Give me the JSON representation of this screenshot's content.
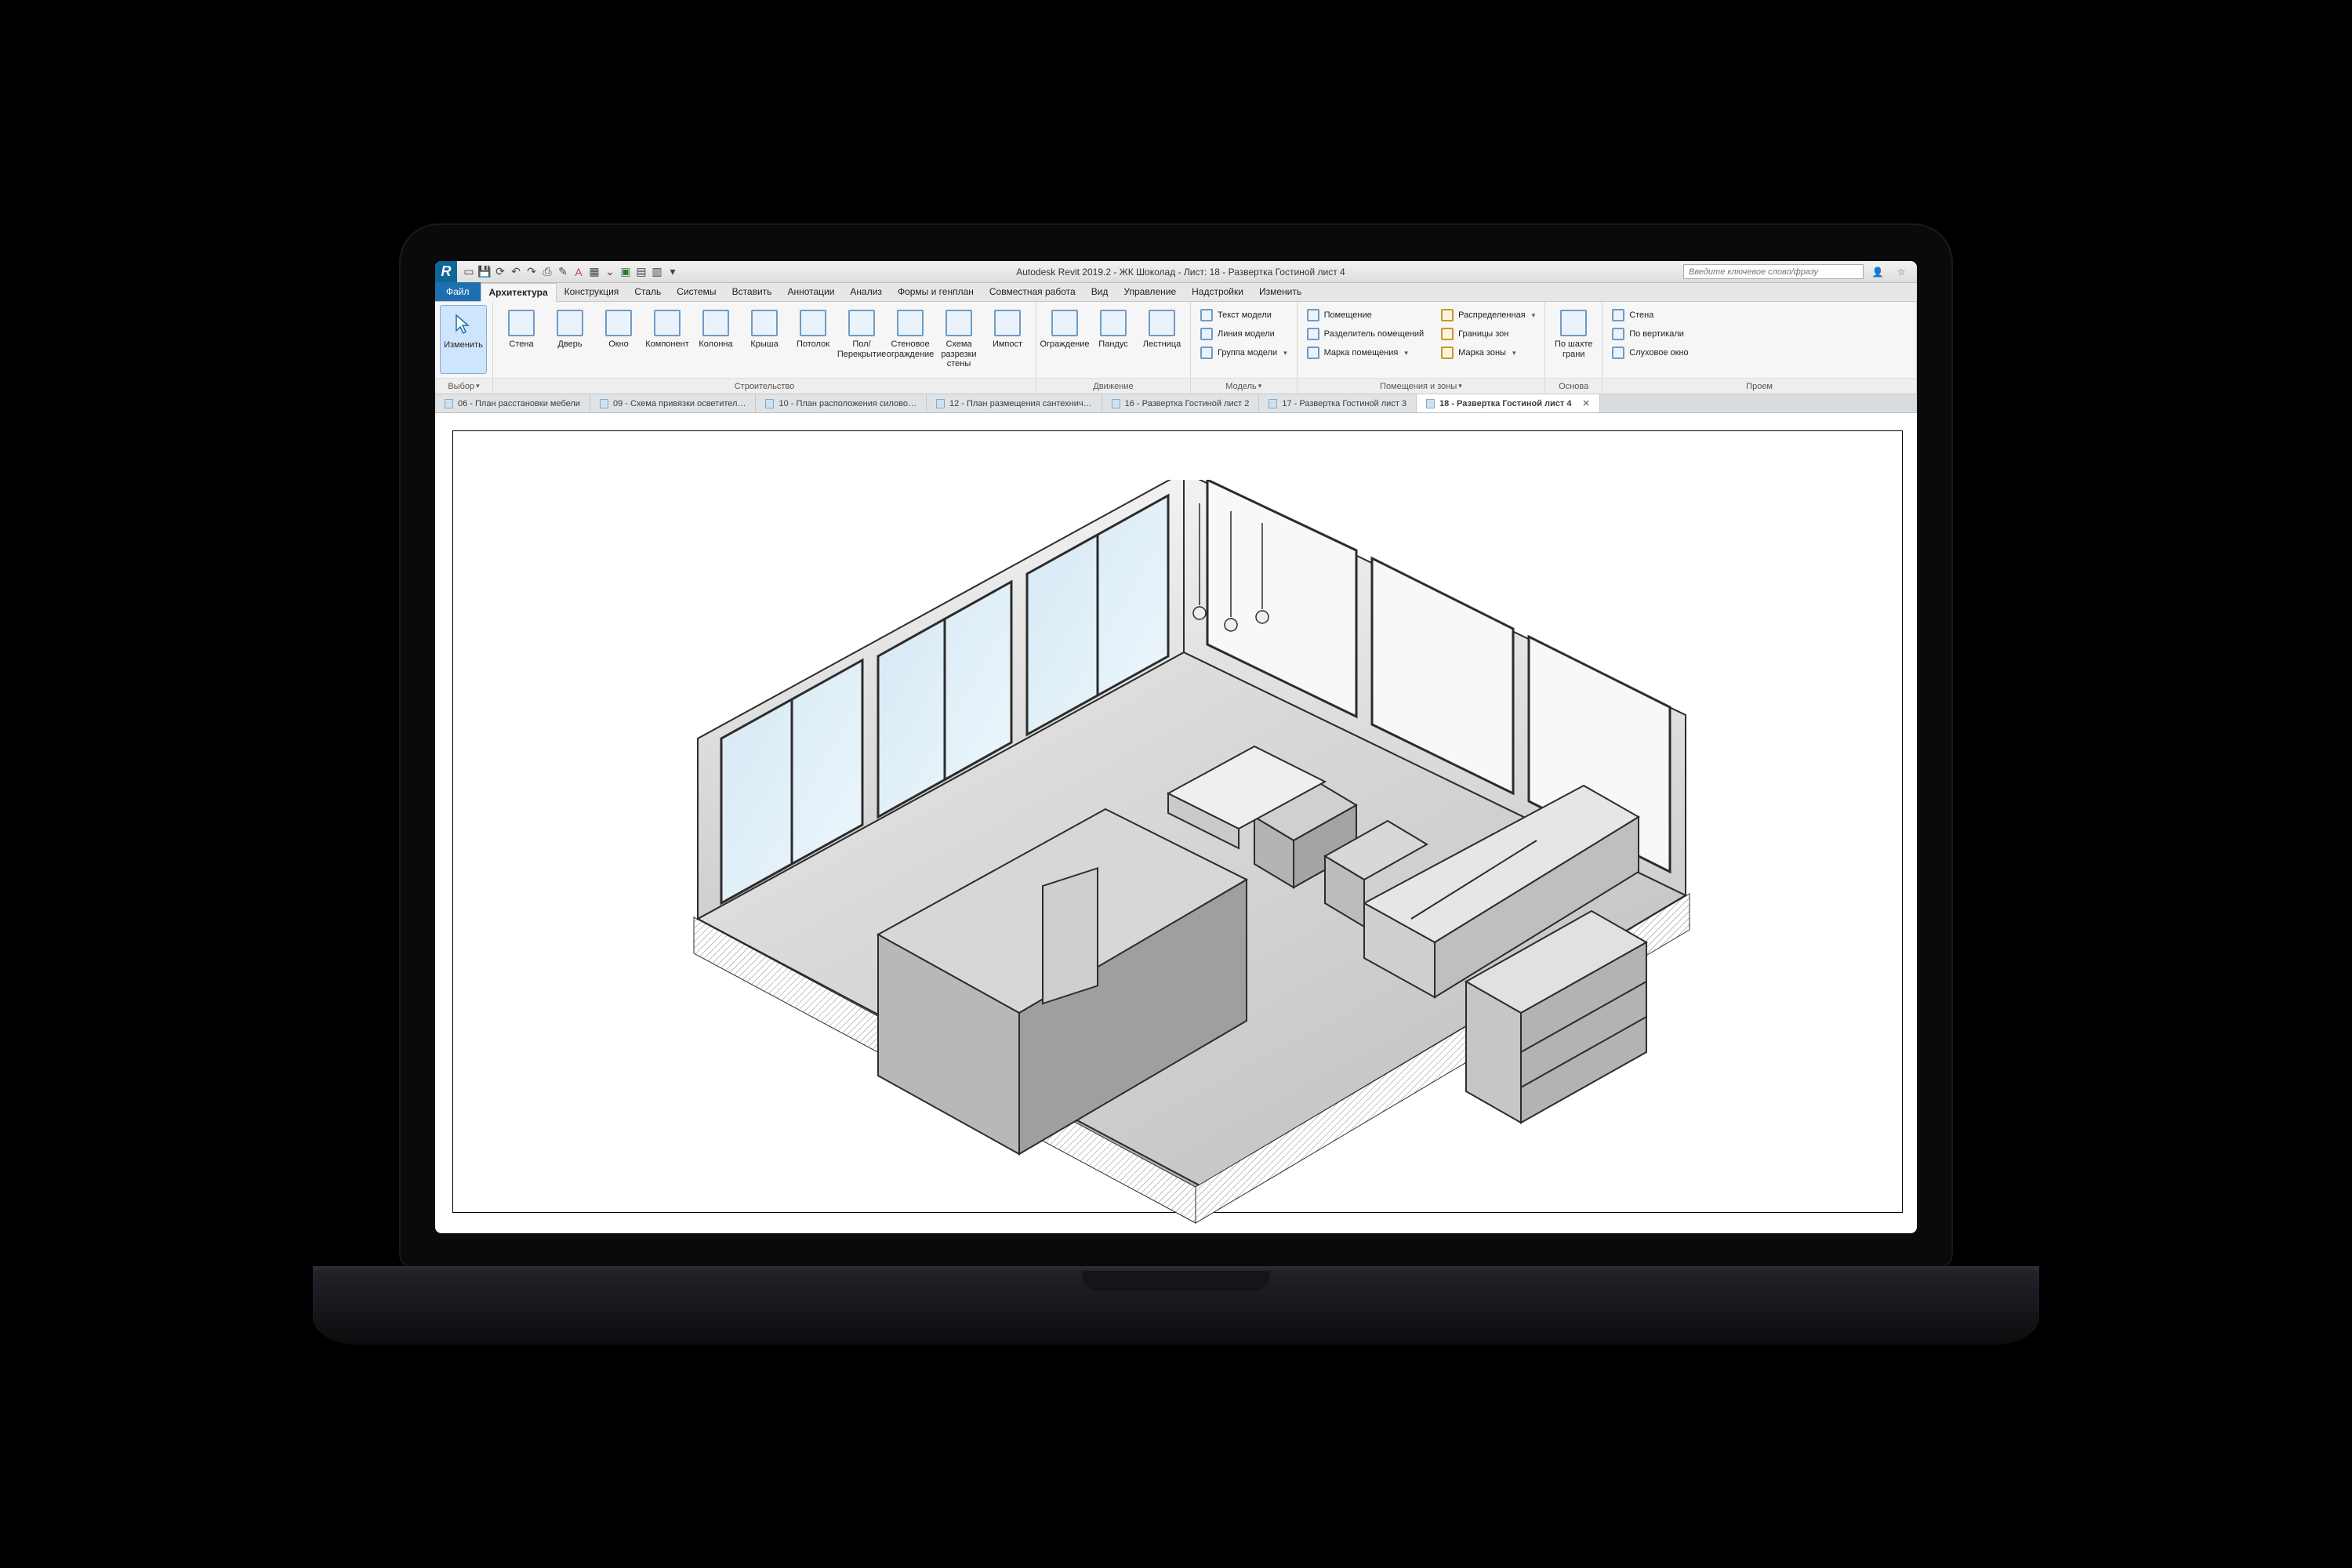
{
  "app": {
    "icon_letter": "R",
    "title": "Autodesk Revit 2019.2 - ЖК Шоколад - Лист: 18 - Развертка Гостиной лист 4"
  },
  "search": {
    "placeholder": "Введите ключевое слово/фразу"
  },
  "file_tab": "Файл",
  "tabs": [
    {
      "label": "Архитектура",
      "active": true
    },
    {
      "label": "Конструкция"
    },
    {
      "label": "Сталь"
    },
    {
      "label": "Системы"
    },
    {
      "label": "Вставить"
    },
    {
      "label": "Аннотации"
    },
    {
      "label": "Анализ"
    },
    {
      "label": "Формы и генплан"
    },
    {
      "label": "Совместная работа"
    },
    {
      "label": "Вид"
    },
    {
      "label": "Управление"
    },
    {
      "label": "Надстройки"
    },
    {
      "label": "Изменить"
    }
  ],
  "ribbon": {
    "select": {
      "label": "Выбор",
      "modify": "Изменить"
    },
    "build": {
      "label": "Строительство",
      "items": [
        "Стена",
        "Дверь",
        "Окно",
        "Компонент",
        "Колонна",
        "Крыша",
        "Потолок",
        "Пол/Перекрытие",
        "Стеновое\nограждение",
        "Схема разрезки\nстены",
        "Импост"
      ]
    },
    "motion": {
      "label": "Движение",
      "items": [
        "Ограждение",
        "Пандус",
        "Лестница"
      ]
    },
    "model": {
      "label": "Модель",
      "rows": [
        "Текст модели",
        "Линия модели",
        "Группа модели"
      ]
    },
    "rooms": {
      "label": "Помещения и зоны",
      "left": [
        "Помещение",
        "Разделитель помещений",
        "Марка помещения"
      ],
      "right_top": "Распределенная",
      "right_mid": "Границы зон",
      "right_bot": "Марка зоны"
    },
    "basis": {
      "label": "Основа",
      "items": [
        "По шахте\nграни"
      ]
    },
    "opening": {
      "label": "Проем",
      "rows": [
        "Стена",
        "По вертикали",
        "Слуховое окно"
      ]
    }
  },
  "doc_tabs": [
    {
      "label": "06 - План расстановки мебели"
    },
    {
      "label": "09 - Схема привязки осветител…"
    },
    {
      "label": "10 - План расположения силово…"
    },
    {
      "label": "12 - План размещения сантехнич…"
    },
    {
      "label": "16 - Развертка Гостиной лист 2"
    },
    {
      "label": "17 - Развертка Гостиной лист 3"
    },
    {
      "label": "18 - Развертка Гостиной лист 4",
      "active": true
    }
  ]
}
